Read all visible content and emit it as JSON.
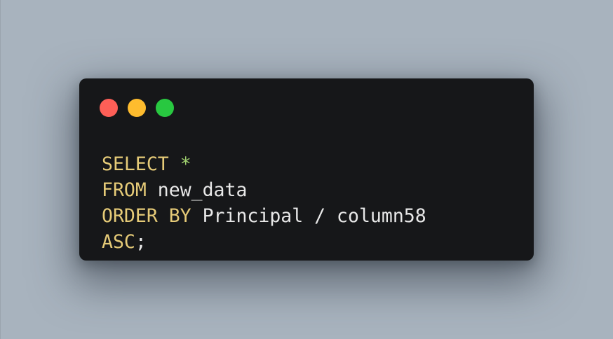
{
  "colors": {
    "background": "#a8b3be",
    "window_background": "#161719",
    "keyword": "#e6cb78",
    "wildcard": "#9fcf6e",
    "identifier": "#e8e8e8"
  },
  "window": {
    "controls": [
      {
        "name": "close",
        "color": "#fe5f57"
      },
      {
        "name": "minimize",
        "color": "#febc2e"
      },
      {
        "name": "maximize",
        "color": "#28c840"
      }
    ]
  },
  "code": {
    "lines": [
      [
        {
          "text": "SELECT",
          "type": "keyword"
        },
        {
          "text": " ",
          "type": "plain"
        },
        {
          "text": "*",
          "type": "wildcard"
        }
      ],
      [
        {
          "text": "FROM",
          "type": "keyword"
        },
        {
          "text": " new_data",
          "type": "identifier"
        }
      ],
      [
        {
          "text": "ORDER BY",
          "type": "keyword"
        },
        {
          "text": " Principal / column58",
          "type": "identifier"
        }
      ],
      [
        {
          "text": "ASC",
          "type": "keyword"
        },
        {
          "text": ";",
          "type": "identifier"
        }
      ]
    ]
  }
}
